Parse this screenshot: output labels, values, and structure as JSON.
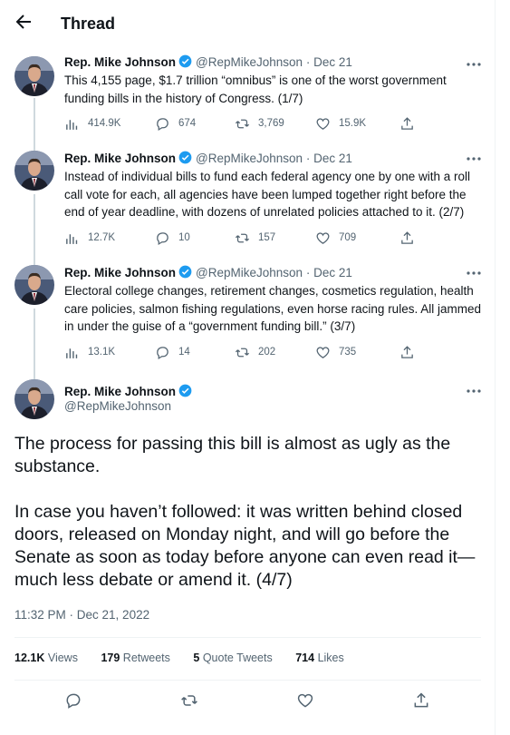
{
  "header": {
    "title": "Thread",
    "back_icon": "arrow-left-icon"
  },
  "colors": {
    "verified": "#1d9bf0",
    "secondary_text": "#536471",
    "primary_text": "#0f1419",
    "thread_line": "#cfd9de"
  },
  "tweets": [
    {
      "name": "Rep. Mike Johnson",
      "handle": "@RepMikeJohnson",
      "separator": "·",
      "date": "Dec 21",
      "text": "This 4,155 page, $1.7 trillion “omnibus” is one of the worst government funding bills in the history of Congress. (1/7)",
      "views": "414.9K",
      "replies": "674",
      "retweets": "3,769",
      "likes": "15.9K"
    },
    {
      "name": "Rep. Mike Johnson",
      "handle": "@RepMikeJohnson",
      "separator": "·",
      "date": "Dec 21",
      "text": "Instead of individual bills to fund each federal agency one by one with a roll call vote for each, all agencies have been lumped together right before the end of year deadline, with dozens of unrelated policies attached to it. (2/7)",
      "views": "12.7K",
      "replies": "10",
      "retweets": "157",
      "likes": "709"
    },
    {
      "name": "Rep. Mike Johnson",
      "handle": "@RepMikeJohnson",
      "separator": "·",
      "date": "Dec 21",
      "text": "Electoral college changes, retirement changes, cosmetics regulation, health care policies, salmon fishing regulations, even horse racing rules. All jammed in under the guise of a “government funding bill.” (3/7)",
      "views": "13.1K",
      "replies": "14",
      "retweets": "202",
      "likes": "735"
    }
  ],
  "main_tweet": {
    "name": "Rep. Mike Johnson",
    "handle": "@RepMikeJohnson",
    "paragraph_1": "The process for passing this bill is almost as ugly as the substance.",
    "paragraph_2": "In case you haven’t followed: it was written behind closed doors, released on Monday night, and will go before the Senate as soon as today before anyone can even read it—much less debate or amend it. (4/7)",
    "timestamp": "11:32 PM · Dec 21, 2022",
    "stats": {
      "views_count": "12.1K",
      "views_label": "Views",
      "retweets_count": "179",
      "retweets_label": "Retweets",
      "quotes_count": "5",
      "quotes_label": "Quote Tweets",
      "likes_count": "714",
      "likes_label": "Likes"
    }
  }
}
